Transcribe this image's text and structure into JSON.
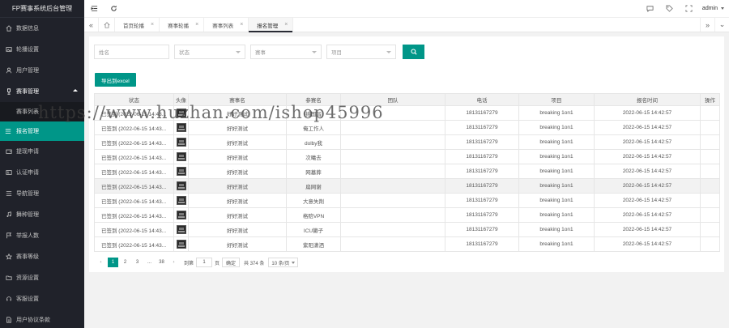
{
  "app": {
    "title": "FP赛事系统后台管理",
    "user": "admin"
  },
  "sidebar": {
    "items": [
      {
        "label": "数据信息",
        "icon": "home-icon"
      },
      {
        "label": "轮播设置",
        "icon": "image-icon"
      },
      {
        "label": "用户管理",
        "icon": "user-icon"
      },
      {
        "label": "赛事管理",
        "icon": "trophy-icon",
        "open": true
      }
    ],
    "sub": [
      {
        "label": "赛事列表"
      },
      {
        "label": "报名管理",
        "active": true
      }
    ],
    "rest": [
      {
        "label": "提现申请",
        "icon": "wallet-icon"
      },
      {
        "label": "认证申请",
        "icon": "id-card-icon"
      },
      {
        "label": "导航管理",
        "icon": "nav-icon"
      },
      {
        "label": "舞种管理",
        "icon": "music-icon"
      },
      {
        "label": "举报人数",
        "icon": "flag-icon"
      },
      {
        "label": "赛事等级",
        "icon": "star-icon"
      },
      {
        "label": "资源设置",
        "icon": "folder-icon"
      },
      {
        "label": "客服设置",
        "icon": "headset-icon"
      },
      {
        "label": "用户协议条款",
        "icon": "doc-icon"
      }
    ]
  },
  "tabs": [
    {
      "label": "首页轮播",
      "active": false
    },
    {
      "label": "赛事轮播",
      "active": false
    },
    {
      "label": "赛事列表",
      "active": false
    },
    {
      "label": "报名管理",
      "active": true
    }
  ],
  "filters": {
    "name_placeholder": "姓名",
    "status_placeholder": "状态",
    "event_placeholder": "赛事",
    "project_placeholder": "项目"
  },
  "export_label": "导出到excel",
  "table": {
    "columns": [
      "状态",
      "头像",
      "赛事名",
      "参赛名",
      "团队",
      "电话",
      "项目",
      "报名时间",
      "操作"
    ],
    "rows": [
      {
        "status": "已签到 (2022-06-15 14:43...",
        "event": "好好测试",
        "name": "摇国昌",
        "team": "",
        "phone": "18131167279",
        "project": "breaking 1on1",
        "time": "2022-06-15 14:42:57"
      },
      {
        "status": "已签到 (2022-06-15 14:43...",
        "event": "好好测试",
        "name": "俺工作人",
        "team": "",
        "phone": "18131167279",
        "project": "breaking 1on1",
        "time": "2022-06-15 14:42:57"
      },
      {
        "status": "已签到 (2022-06-15 14:43...",
        "event": "好好测试",
        "name": "dolby我",
        "team": "",
        "phone": "18131167279",
        "project": "breaking 1on1",
        "time": "2022-06-15 14:42:57"
      },
      {
        "status": "已签到 (2022-06-15 14:43...",
        "event": "好好测试",
        "name": "次曦去",
        "team": "",
        "phone": "18131167279",
        "project": "breaking 1on1",
        "time": "2022-06-15 14:42:57"
      },
      {
        "status": "已签到 (2022-06-15 14:43...",
        "event": "好好测试",
        "name": "网墓葬",
        "team": "",
        "phone": "18131167279",
        "project": "breaking 1on1",
        "time": "2022-06-15 14:42:57"
      },
      {
        "status": "已签到 (2022-06-15 14:43...",
        "event": "好好测试",
        "name": "扁网谢",
        "team": "",
        "phone": "18131167279",
        "project": "breaking 1on1",
        "time": "2022-06-15 14:42:57"
      },
      {
        "status": "已签到 (2022-06-15 14:43...",
        "event": "好好测试",
        "name": "大意失荆",
        "team": "",
        "phone": "18131167279",
        "project": "breaking 1on1",
        "time": "2022-06-15 14:42:57"
      },
      {
        "status": "已签到 (2022-06-15 14:43...",
        "event": "好好测试",
        "name": "格赔VPN",
        "team": "",
        "phone": "18131167279",
        "project": "breaking 1on1",
        "time": "2022-06-15 14:42:57"
      },
      {
        "status": "已签到 (2022-06-15 14:43...",
        "event": "好好测试",
        "name": "ICU獭子",
        "team": "",
        "phone": "18131167279",
        "project": "breaking 1on1",
        "time": "2022-06-15 14:42:57"
      },
      {
        "status": "已签到 (2022-06-15 14:43...",
        "event": "好好测试",
        "name": "紫阳潇洒",
        "team": "",
        "phone": "18131167279",
        "project": "breaking 1on1",
        "time": "2022-06-15 14:42:57"
      }
    ]
  },
  "pager": {
    "prev": "‹",
    "next": "›",
    "pages": [
      "1",
      "2",
      "3",
      "...",
      "38"
    ],
    "current": "1",
    "goto_label": "到第",
    "goto_value": "1",
    "page_unit": "页",
    "confirm": "确定",
    "total": "共 374 条",
    "size": "10 条/页"
  },
  "watermark": "https://www.huzhan.com/ishop45996",
  "colors": {
    "accent": "#009688",
    "sidebar_bg": "#20222a"
  }
}
